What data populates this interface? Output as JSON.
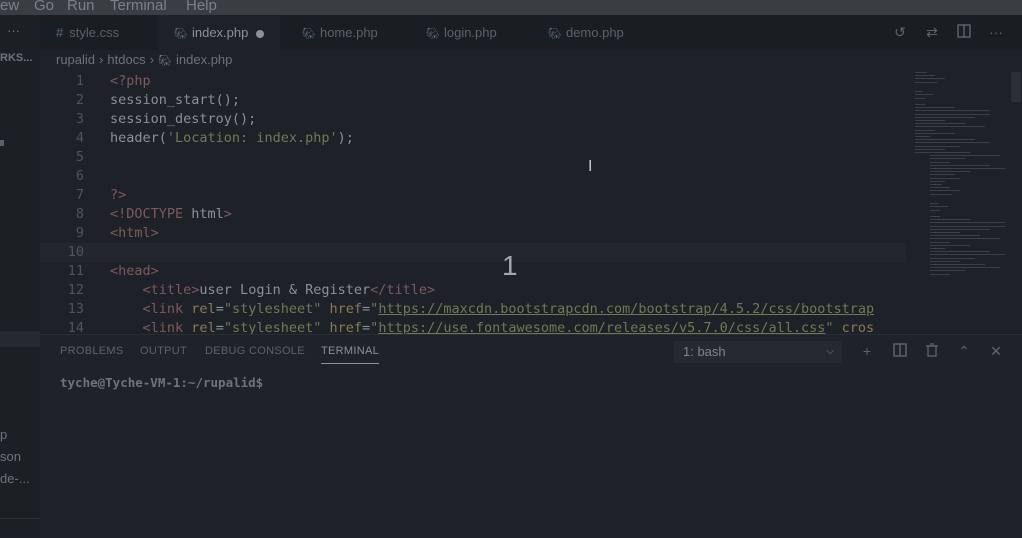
{
  "menubar": {
    "items": [
      "ew",
      "Go",
      "Run",
      "Terminal",
      "Help"
    ]
  },
  "sidebar": {
    "more": "···",
    "title": "RKS...",
    "items": [
      "p",
      "son",
      "de-..."
    ]
  },
  "tabs": [
    {
      "name": "style.css",
      "type": "css"
    },
    {
      "name": "index.php",
      "type": "php",
      "active": true,
      "modified": true
    },
    {
      "name": "home.php",
      "type": "php"
    },
    {
      "name": "login.php",
      "type": "php"
    },
    {
      "name": "demo.php",
      "type": "php"
    }
  ],
  "tab_actions": [
    "history-icon",
    "compare-icon",
    "split-editor-icon",
    "more-icon"
  ],
  "breadcrumb": [
    "rupalid",
    "htdocs",
    "index.php"
  ],
  "editor": {
    "lines": [
      {
        "n": "1",
        "html": "<span class=\"kw\">&lt;?php</span>"
      },
      {
        "n": "2",
        "html": "session_start();"
      },
      {
        "n": "3",
        "html": "session_destroy();"
      },
      {
        "n": "4",
        "html": "header(<span class=\"str\">'Location: index.php'</span>);"
      },
      {
        "n": "5",
        "html": ""
      },
      {
        "n": "6",
        "html": ""
      },
      {
        "n": "7",
        "html": "<span class=\"kw\">?&gt;</span>"
      },
      {
        "n": "8",
        "html": "<span class=\"kw\">&lt;!DOCTYPE</span> html<span class=\"kw\">&gt;</span>"
      },
      {
        "n": "9",
        "html": "<span class=\"kw\">&lt;html&gt;</span>"
      },
      {
        "n": "10",
        "html": "",
        "current": true
      },
      {
        "n": "11",
        "html": "<span class=\"kw\">&lt;head&gt;</span>"
      },
      {
        "n": "12",
        "html": "    <span class=\"kw\">&lt;title&gt;</span>user Login &amp; Register<span class=\"kw\">&lt;/title&gt;</span>"
      },
      {
        "n": "13",
        "html": "    <span class=\"kw\">&lt;link</span> <span class=\"attr\">rel</span>=<span class=\"str\">\"stylesheet\"</span> <span class=\"attr\">href</span>=<span class=\"str\">\"</span><span class=\"url\">https://maxcdn.bootstrapcdn.com/bootstrap/4.5.2/css/bootstrap</span>"
      },
      {
        "n": "14",
        "html": "    <span class=\"kw\">&lt;link</span> <span class=\"attr\">rel</span>=<span class=\"str\">\"stylesheet\"</span> <span class=\"attr\">href</span>=<span class=\"str\">\"</span><span class=\"url\">https://use.fontawesome.com/releases/v5.7.0/css/all.css</span><span class=\"str\">\"</span> <span class=\"attr\">cros</span>"
      }
    ]
  },
  "overlay": {
    "counter": "1"
  },
  "panel": {
    "tabs": [
      "PROBLEMS",
      "OUTPUT",
      "DEBUG CONSOLE",
      "TERMINAL"
    ],
    "active_tab": "TERMINAL",
    "terminal_select": "1: bash",
    "prompt": "tyche@Tyche-VM-1:~/rupalid$"
  },
  "colors": {
    "background": "#1e2228",
    "tabbar": "#1a1d21",
    "panel": "#1f2329"
  }
}
